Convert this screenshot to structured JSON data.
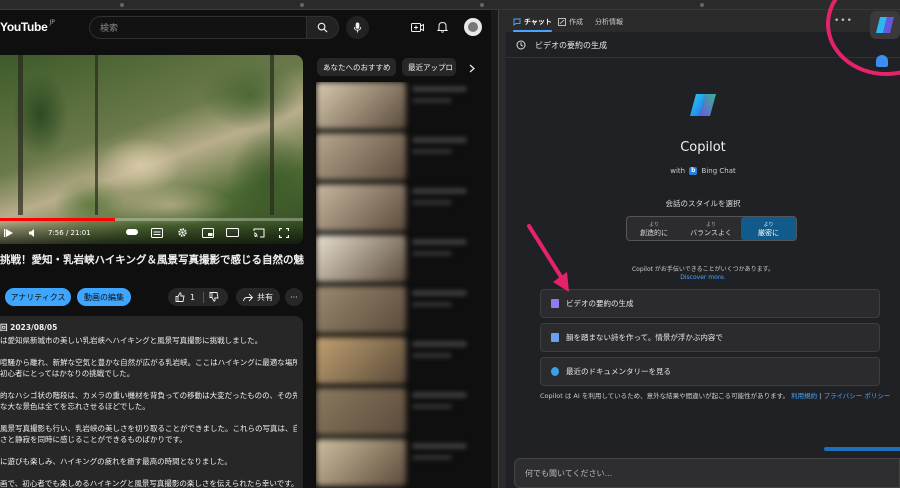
{
  "youtube": {
    "logo_text": "YouTube",
    "logo_region": "JP",
    "search_placeholder": "検索",
    "video": {
      "time": "7:56 / 21:01",
      "progress": 0.38,
      "title": "挑戦！愛知・乳岩峡ハイキング＆風景写真撮影で感じる自然の魅",
      "analytics_label": "アナリティクス",
      "edit_label": "動画の編集",
      "like_count": "1",
      "share_label": "共有",
      "more_label": "···"
    },
    "description": {
      "meta": "回 2023/08/05",
      "lines": [
        "は愛知県新城市の美しい乳岩峡へハイキングと風景写真撮影に挑戦しました。",
        "",
        "喧騒から離れ、新鮮な空気と豊かな自然が広がる乳岩峡。ここはハイキングに最適な場所で",
        "初心者にとってはかなりの挑戦でした。",
        "",
        "的なハシゴ状の階段は、カメラの重い機材を背負っての移動は大変だったものの、その先に",
        "な大な景色は全てを忘れさせるほどでした。",
        "",
        "風景写真撮影も行い、乳岩峡の美しさを切り取ることができました。これらの写真は、自然",
        "さと静寂を同時に感じることができるものばかりです。",
        "",
        "に遊びも楽しみ、ハイキングの疲れを癒す最高の時間となりました。",
        "",
        "画で、初心者でも楽しめるハイキングと風景写真撮影の楽しさを伝えられたら幸いです。"
      ]
    },
    "chips": [
      "あなたへのおすすめ",
      "最近アップロ"
    ],
    "rec_thumb_colors": [
      "#d8c9b0",
      "#b8a890",
      "#c8b8a0",
      "#e8e0d0",
      "#9a8a70",
      "#c0a070",
      "#8a7a60",
      "#d0c0a0"
    ]
  },
  "copilot": {
    "tabs": [
      "チャット",
      "作成",
      "分析情報"
    ],
    "more": "•••",
    "subbar_title": "ビデオの要約の生成",
    "name": "Copilot",
    "with_prefix": "with",
    "with_brand": "Bing Chat",
    "style_label": "会話のスタイルを選択",
    "styles": [
      {
        "small": "より",
        "label": "創造的に"
      },
      {
        "small": "より",
        "label": "バランスよく"
      },
      {
        "small": "より",
        "label": "厳密に"
      }
    ],
    "selected_style": 2,
    "help_text": "Copilot がお手伝いできることがいくつかあります。",
    "discover": "Discover more.",
    "suggestions": [
      {
        "label": "ビデオの要約の生成",
        "color": "#8e7cf0"
      },
      {
        "label": "韻を踏まない詩を作って。情景が浮かぶ内容で",
        "color": "#6aa0f0"
      },
      {
        "label": "最近のドキュメンタリーを見る",
        "color": "#3aa0e8"
      }
    ],
    "disclaimer": "Copilot は AI を利用しているため、意外な結果や間違いが起こる可能性があります。",
    "terms": "利用規約",
    "separator": "|",
    "privacy": "プライバシー ポリシー",
    "input_placeholder": "何でも聞いてください..."
  },
  "colors": {
    "accent_blue": "#3ea6ff",
    "highlight": "#e6236a",
    "progress_red": "#ff0000"
  }
}
